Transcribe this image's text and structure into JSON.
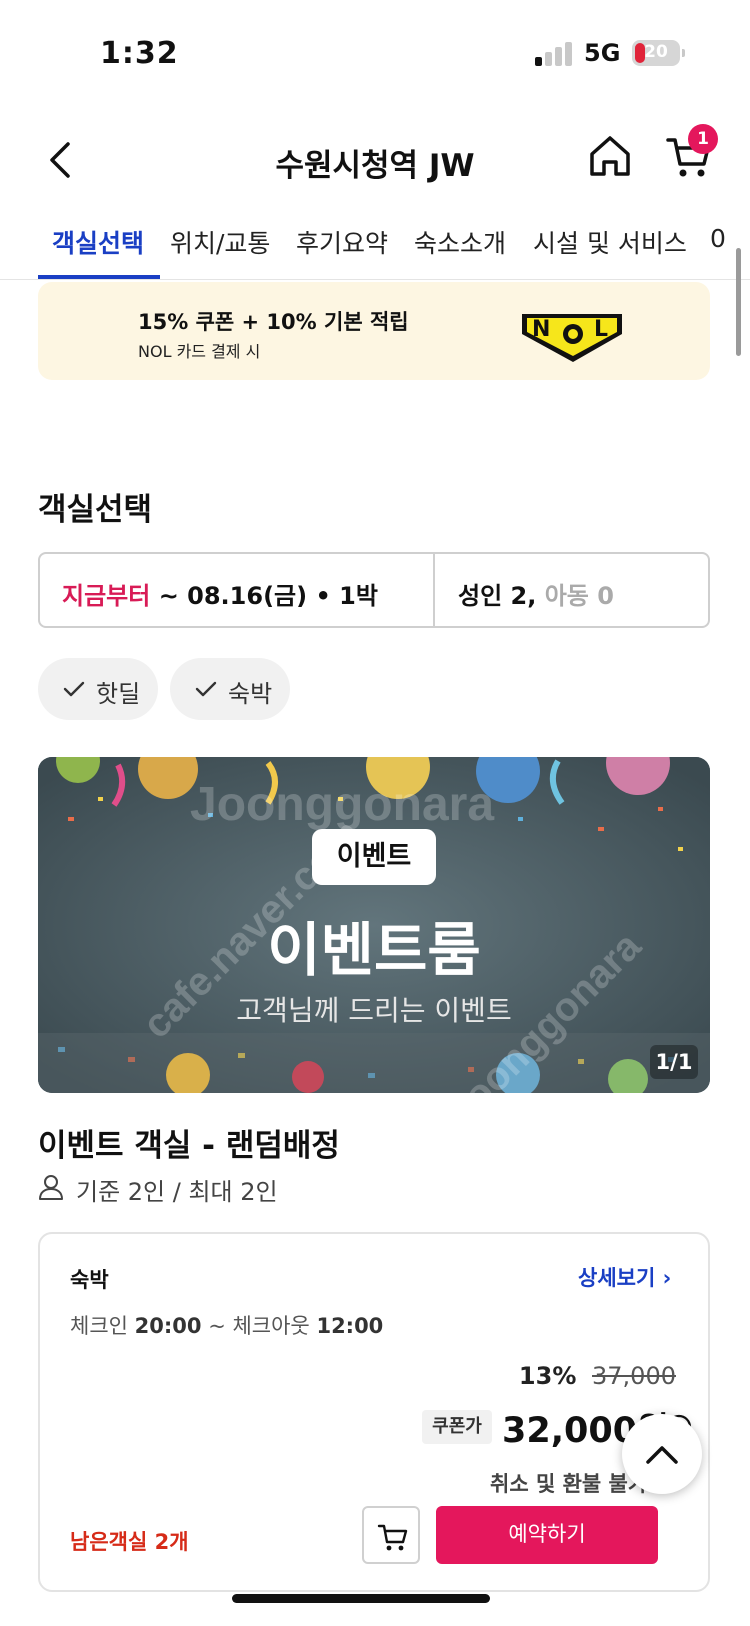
{
  "status_bar": {
    "time": "1:32",
    "network": "5G",
    "battery": "20"
  },
  "header": {
    "title": "수원시청역 JW",
    "cart_count": "1"
  },
  "tabs": [
    {
      "label": "객실선택",
      "active": true
    },
    {
      "label": "위치/교통"
    },
    {
      "label": "후기요약"
    },
    {
      "label": "숙소소개"
    },
    {
      "label": "시설 및 서비스"
    },
    {
      "label": "0"
    }
  ],
  "promo": {
    "headline": "15% 쿠폰 + 10% 기본 적립",
    "subtext": "NOL 카드 결제 시",
    "logo_text": "NOL"
  },
  "room_selection": {
    "title": "객실선택",
    "date": {
      "accent": "지금부터",
      "range": "~ 08.16(금) • 1박"
    },
    "guests": {
      "adults": "성인 2,",
      "children": "아동 0"
    },
    "filters": [
      "핫딜",
      "숙박"
    ]
  },
  "room": {
    "image": {
      "badge": "이벤트",
      "title": "이벤트룸",
      "subtitle": "고객님께 드리는 이벤트",
      "counter": "1/1",
      "watermarks": [
        "Joonggonara",
        "cafe.naver.com",
        "Joonggonara"
      ]
    },
    "name": "이벤트 객실 - 랜덤배정",
    "occupancy": "기준 2인 / 최대 2인",
    "rate": {
      "stay_type": "숙박",
      "detail_link": "상세보기 ›",
      "checkin_label": "체크인",
      "checkin_time": "20:00",
      "checkout_label": "~ 체크아웃",
      "checkout_time": "12:00",
      "discount_pct": "13%",
      "original_price": "37,000",
      "coupon_label": "쿠폰가",
      "final_price": "32,000원",
      "refund_note": "취소 및 환불 불가",
      "rooms_left": "남은객실 2개",
      "reserve_label": "예약하기"
    }
  },
  "colors": {
    "accent_blue": "#1a3fc4",
    "accent_pink": "#e4175c",
    "warning_red": "#d62b18",
    "promo_bg": "#fdf6e2"
  }
}
